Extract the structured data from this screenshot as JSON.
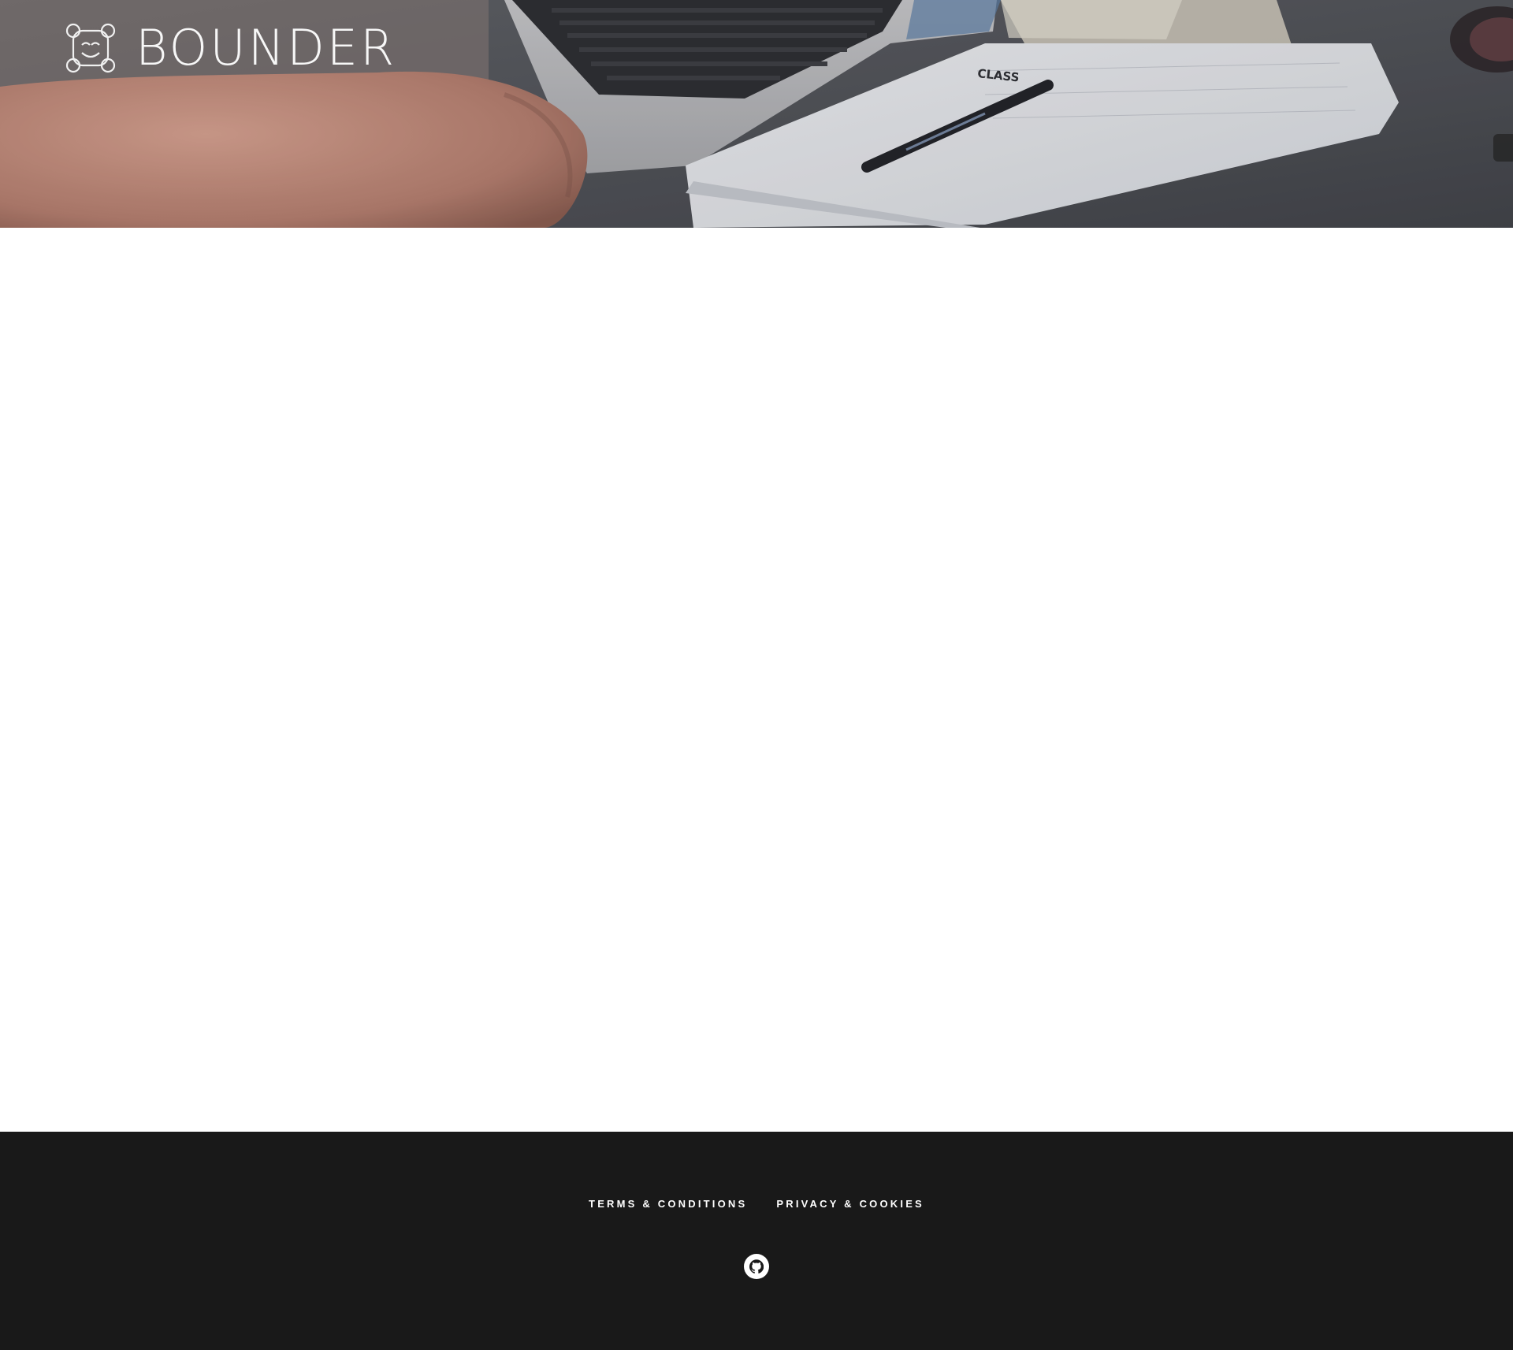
{
  "header": {
    "brand_name": "BOUNDER",
    "logo_icon": "smiling-robot-face-icon",
    "background_image": "laptop-notebook-pen-desk-photo"
  },
  "footer": {
    "links": [
      {
        "label": "TERMS & CONDITIONS"
      },
      {
        "label": "PRIVACY & COOKIES"
      }
    ],
    "social": [
      {
        "icon": "github-icon"
      }
    ],
    "background_color": "#191919"
  },
  "colors": {
    "hero_tint": "#4a4c52",
    "page_background": "#ffffff",
    "footer_text": "#ffffff"
  }
}
